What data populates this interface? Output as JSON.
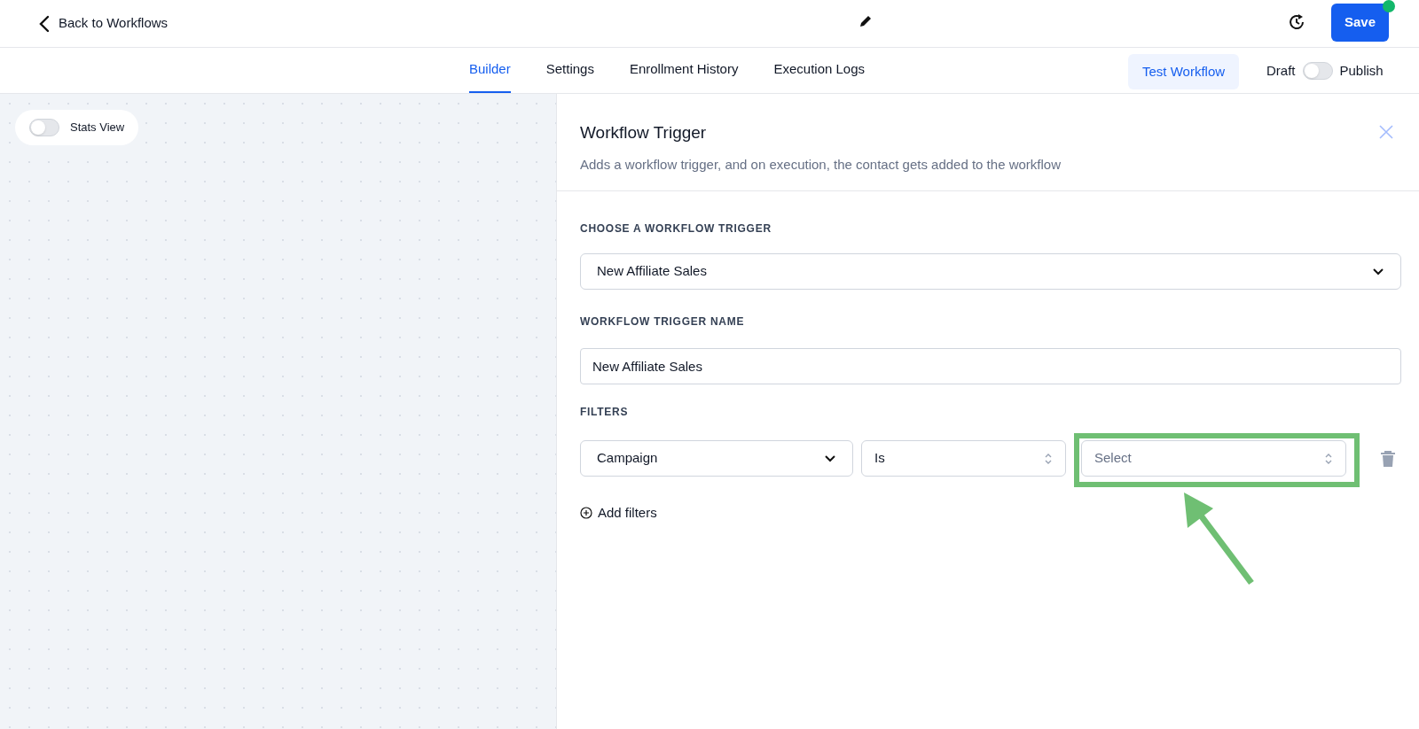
{
  "header": {
    "back_link": "Back to Workflows",
    "save_button": "Save",
    "save_has_notification": true
  },
  "tabs": [
    {
      "label": "Builder",
      "selected": true
    },
    {
      "label": "Settings",
      "selected": false
    },
    {
      "label": "Enrollment History",
      "selected": false
    },
    {
      "label": "Execution Logs",
      "selected": false
    }
  ],
  "test_button": "Test Workflow",
  "publish_toggle": {
    "off_label": "Draft",
    "on_label": "Publish",
    "on": false
  },
  "canvas": {
    "stats_toggle": {
      "label": "Stats View",
      "on": false
    }
  },
  "panel": {
    "title": "Workflow Trigger",
    "subtitle": "Adds a workflow trigger, and on execution, the contact gets added to the workflow",
    "trigger_label": "CHOOSE A WORKFLOW TRIGGER",
    "trigger_value": "New Affiliate Sales",
    "name_label": "WORKFLOW TRIGGER NAME",
    "name_value": "New Affiliate Sales",
    "filters_label": "FILTERS",
    "filters": [
      {
        "field": "Campaign",
        "operator": "Is",
        "value_placeholder": "Select",
        "highlighted": true
      }
    ],
    "add_filters": "Add filters"
  }
}
